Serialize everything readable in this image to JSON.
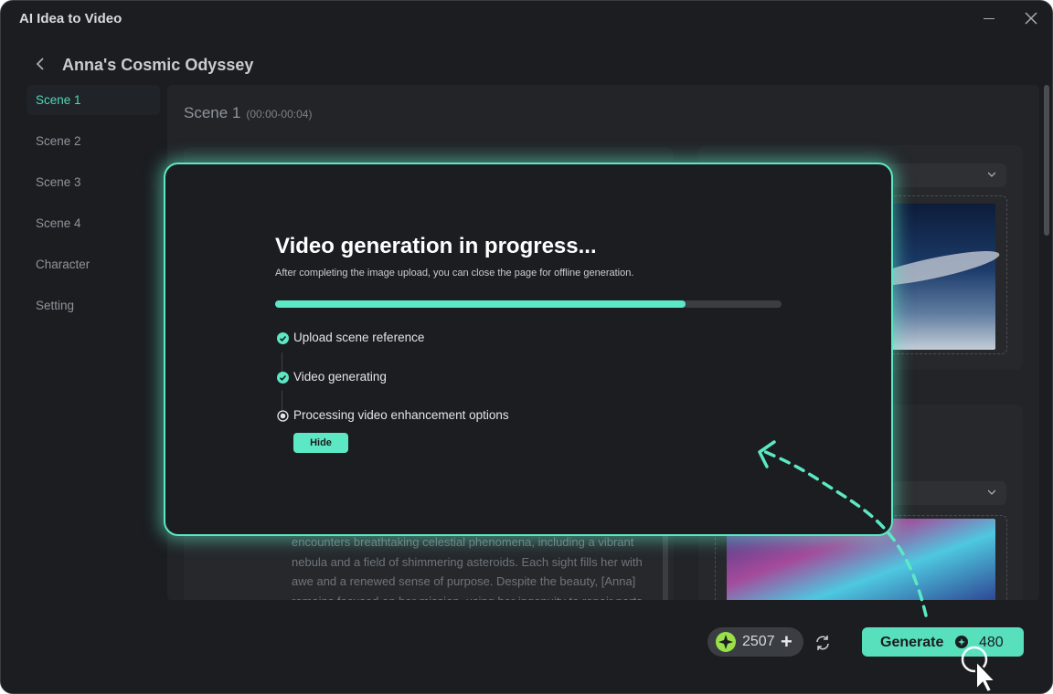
{
  "window": {
    "title": "AI Idea to Video"
  },
  "header": {
    "project_title": "Anna's Cosmic Odyssey"
  },
  "sidebar": {
    "items": [
      {
        "label": "Scene 1",
        "active": true
      },
      {
        "label": "Scene 2",
        "active": false
      },
      {
        "label": "Scene 3",
        "active": false
      },
      {
        "label": "Scene 4",
        "active": false
      },
      {
        "label": "Character",
        "active": false
      },
      {
        "label": "Setting",
        "active": false
      }
    ]
  },
  "scene": {
    "title": "Scene 1",
    "time_range": "(00:00-00:04)",
    "description": "encounters breathtaking celestial phenomena, including a vibrant nebula and a field of shimmering asteroids. Each sight fills her with awe and a renewed sense of purpose. Despite the beauty, [Anna] remains focused on her mission, using her ingenuity to repair parts"
  },
  "modal": {
    "title": "Video generation in progress...",
    "subtitle": "After completing the image upload, you can close the page for offline generation.",
    "progress_fraction": 0.81,
    "steps": [
      {
        "label": "Upload scene reference",
        "status": "done"
      },
      {
        "label": "Video generating",
        "status": "done"
      },
      {
        "label": "Processing video enhancement options",
        "status": "in-progress"
      }
    ],
    "hide_label": "Hide"
  },
  "footer": {
    "credits": "2507",
    "credits_add": "+",
    "generate_label": "Generate",
    "generate_cost": "480"
  },
  "colors": {
    "accent": "#5ce8c4",
    "background": "#1b1d21",
    "credit_icon": "#9ae04a"
  }
}
